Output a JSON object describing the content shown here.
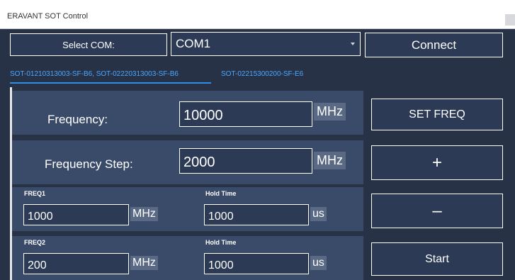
{
  "window": {
    "title": "ERAVANT SOT Control"
  },
  "com": {
    "label": "Select COM:",
    "value": "COM1",
    "connect_label": "Connect"
  },
  "tabs": [
    {
      "label": "SOT-01210313003-SF-B6, SOT-02220313003-SF-B6",
      "active": true
    },
    {
      "label": "SOT-02215300200-SF-E6",
      "active": false
    }
  ],
  "frequency": {
    "label": "Frequency:",
    "value": "10000",
    "unit": "MHz"
  },
  "frequency_step": {
    "label": "Frequency Step:",
    "value": "2000",
    "unit": "MHz"
  },
  "freq1": {
    "label": "FREQ1",
    "value": "1000",
    "unit": "MHz",
    "hold_label": "Hold Time",
    "hold_value": "1000",
    "hold_unit": "us"
  },
  "freq2": {
    "label": "FREQ2",
    "value": "200",
    "unit": "MHz",
    "hold_label": "Hold Time",
    "hold_value": "1000",
    "hold_unit": "us"
  },
  "buttons": {
    "set_freq": "SET FREQ",
    "plus": "+",
    "minus": "–",
    "start": "Start"
  },
  "colors": {
    "background": "#273247",
    "panel": "#3a4b6a",
    "accent_tab": "#4aa7ff",
    "unit_bg": "#5a6a84"
  }
}
